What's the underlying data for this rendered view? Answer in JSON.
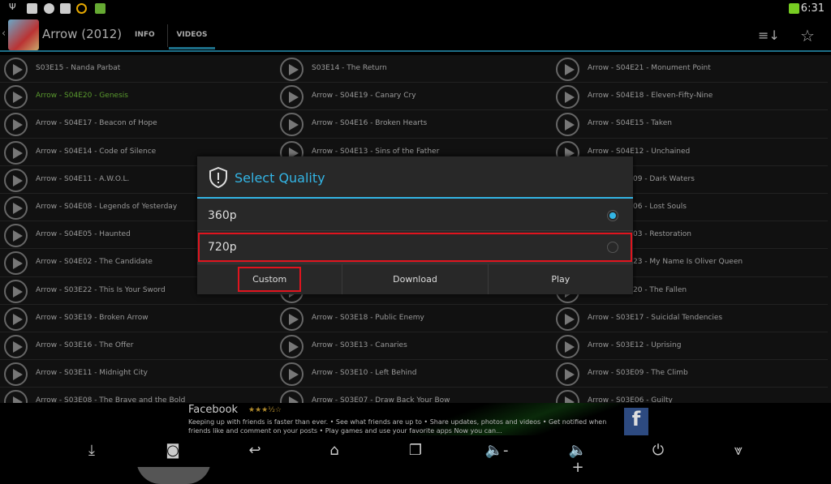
{
  "status_bar": {
    "time": "6:31",
    "icons": [
      "usb-icon",
      "image-icon",
      "shield-icon",
      "gmail-icon",
      "play-circle-icon",
      "app-icon"
    ],
    "right_icons": [
      "network-icon"
    ]
  },
  "action_bar": {
    "title": "Arrow (2012)",
    "tabs": [
      {
        "label": "INFO",
        "selected": false
      },
      {
        "label": "VIDEOS",
        "selected": true
      }
    ],
    "icons": [
      "sort-icon",
      "star-icon"
    ],
    "accent": "#1d6f88"
  },
  "episodes": {
    "columns": [
      [
        "S03E15 - Nanda Parbat",
        "Arrow - S04E20 - Genesis",
        "Arrow - S04E17 - Beacon of Hope",
        "Arrow - S04E14 - Code of Silence",
        "Arrow - S04E11 - A.W.O.L.",
        "Arrow - S04E08 - Legends of Yesterday",
        "Arrow - S04E05 - Haunted",
        "Arrow - S04E02 - The Candidate",
        "Arrow - S03E22 - This Is Your Sword",
        "Arrow - S03E19 - Broken Arrow",
        "Arrow - S03E16 - The Offer",
        "Arrow - S03E11 - Midnight City",
        "Arrow - S03E08 - The Brave and the Bold"
      ],
      [
        "S03E14 - The Return",
        "Arrow - S04E19 - Canary Cry",
        "Arrow - S04E16 - Broken Hearts",
        "Arrow - S04E13 - Sins of the Father",
        "",
        "",
        "",
        "",
        "",
        "Arrow - S03E18 - Public Enemy",
        "Arrow - S03E13 - Canaries",
        "Arrow - S03E10 - Left Behind",
        "Arrow - S03E07 - Draw Back Your Bow"
      ],
      [
        "Arrow - S04E21 - Monument Point",
        "Arrow - S04E18 - Eleven-Fifty-Nine",
        "Arrow - S04E15 - Taken",
        "Arrow - S04E12 - Unchained",
        "09 - Dark Waters",
        "06 - Lost Souls",
        "03 - Restoration",
        "23 - My Name Is Oliver Queen",
        "20 - The Fallen",
        "Arrow - S03E17 - Suicidal Tendencies",
        "Arrow - S03E12 - Uprising",
        "Arrow - S03E09 - The Climb",
        "Arrow - S03E06 - Guilty"
      ]
    ],
    "active": "Arrow - S04E20 - Genesis",
    "active_color": "#5a9a2e"
  },
  "dialog": {
    "title": "Select Quality",
    "icon": "shield-alert-icon",
    "accent": "#33b5e5",
    "options": [
      {
        "label": "360p",
        "selected": true
      },
      {
        "label": "720p",
        "selected": false,
        "highlighted": true
      }
    ],
    "buttons": [
      {
        "label": "Custom",
        "highlighted": true
      },
      {
        "label": "Download"
      },
      {
        "label": "Play"
      }
    ],
    "highlight_color": "#e0141e"
  },
  "ad": {
    "title": "Facebook",
    "rating": 3.5,
    "stars": "★★★½☆",
    "text": "Keeping up with friends is faster than ever. • See what friends are up to • Share updates, photos and videos • Get notified when friends like and comment on your posts • Play games and use your favorite apps Now you can...",
    "info_icon": "info-icon"
  },
  "nav_bar": {
    "icons": [
      "download-icon",
      "screenshot-icon",
      "back-icon",
      "home-icon",
      "recent-apps-icon",
      "volume-down-icon",
      "volume-up-icon",
      "power-icon",
      "collapse-icon"
    ]
  }
}
